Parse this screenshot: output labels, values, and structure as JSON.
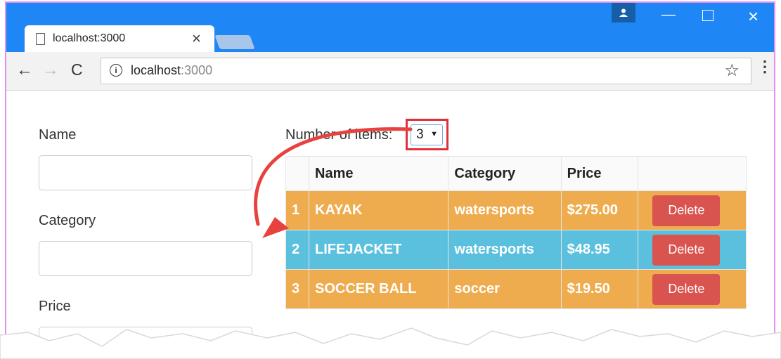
{
  "browser": {
    "tab_title": "localhost:3000",
    "close_glyph": "×",
    "url_host": "localhost",
    "url_port": ":3000",
    "info_glyph": "i",
    "star_glyph": "☆",
    "back_glyph": "←",
    "forward_glyph": "→",
    "reload_glyph": "C",
    "menu_glyph": "⋮",
    "min_glyph": "—",
    "close_window_glyph": "×",
    "accent": "#1f86f5"
  },
  "form": {
    "name_label": "Name",
    "category_label": "Category",
    "price_label": "Price",
    "name_value": "",
    "category_value": "",
    "price_value": ""
  },
  "count": {
    "label": "Number of items:",
    "selected": "3",
    "caret": "▼"
  },
  "table": {
    "headers": [
      "",
      "Name",
      "Category",
      "Price",
      ""
    ],
    "rows": [
      {
        "index": "1",
        "name": "KAYAK",
        "category": "watersports",
        "price": "$275.00",
        "action": "Delete",
        "style": "warning",
        "color": "#efac4e"
      },
      {
        "index": "2",
        "name": "LIFEJACKET",
        "category": "watersports",
        "price": "$48.95",
        "action": "Delete",
        "style": "info",
        "color": "#5bc0de"
      },
      {
        "index": "3",
        "name": "SOCCER BALL",
        "category": "soccer",
        "price": "$19.50",
        "action": "Delete",
        "style": "warning",
        "color": "#efac4e"
      }
    ]
  },
  "colors": {
    "danger": "#d9534f",
    "highlight": "#e0313a",
    "annotation_arrow": "#e8423f"
  }
}
